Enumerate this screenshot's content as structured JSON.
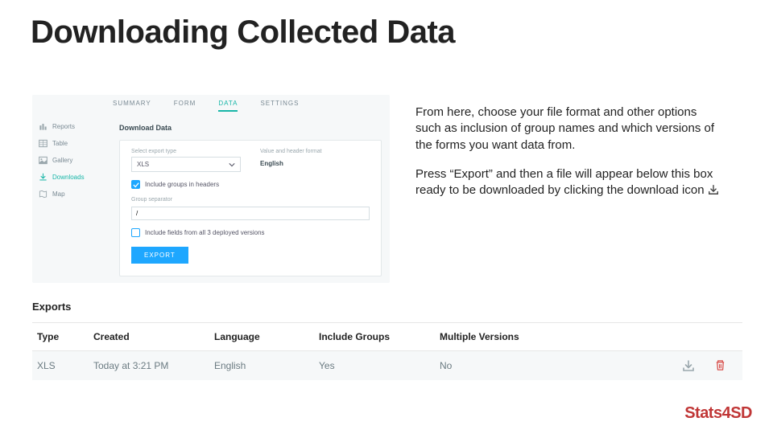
{
  "title": "Downloading Collected Data",
  "instructions": {
    "p1": "From here, choose your file format and other options such as inclusion of group names and which versions of the forms you want data from.",
    "p2_a": "Press “Export” and then a file will appear below this box ready to be downloaded by clicking the download icon "
  },
  "shot": {
    "sidebar": {
      "items": [
        {
          "label": "Reports"
        },
        {
          "label": "Table"
        },
        {
          "label": "Gallery"
        },
        {
          "label": "Downloads"
        },
        {
          "label": "Map"
        }
      ]
    },
    "tabs": {
      "items": [
        {
          "label": "SUMMARY"
        },
        {
          "label": "FORM"
        },
        {
          "label": "DATA"
        },
        {
          "label": "SETTINGS"
        }
      ],
      "active_index": 2
    },
    "panel_title": "Download Data",
    "export_type_label": "Select export type",
    "export_type_value": "XLS",
    "header_format_label": "Value and header format",
    "header_format_value": "English",
    "checkbox1_label": "Include groups in headers",
    "separator_label": "Group separator",
    "separator_value": "/",
    "checkbox2_label": "Include fields from all 3 deployed versions",
    "export_button": "EXPORT"
  },
  "exports": {
    "heading": "Exports",
    "headers": {
      "type": "Type",
      "created": "Created",
      "language": "Language",
      "groups": "Include Groups",
      "multi": "Multiple Versions"
    },
    "rows": [
      {
        "type": "XLS",
        "created": "Today at 3:21 PM",
        "language": "English",
        "groups": "Yes",
        "multi": "No"
      }
    ]
  },
  "brand": "Stats4SD"
}
